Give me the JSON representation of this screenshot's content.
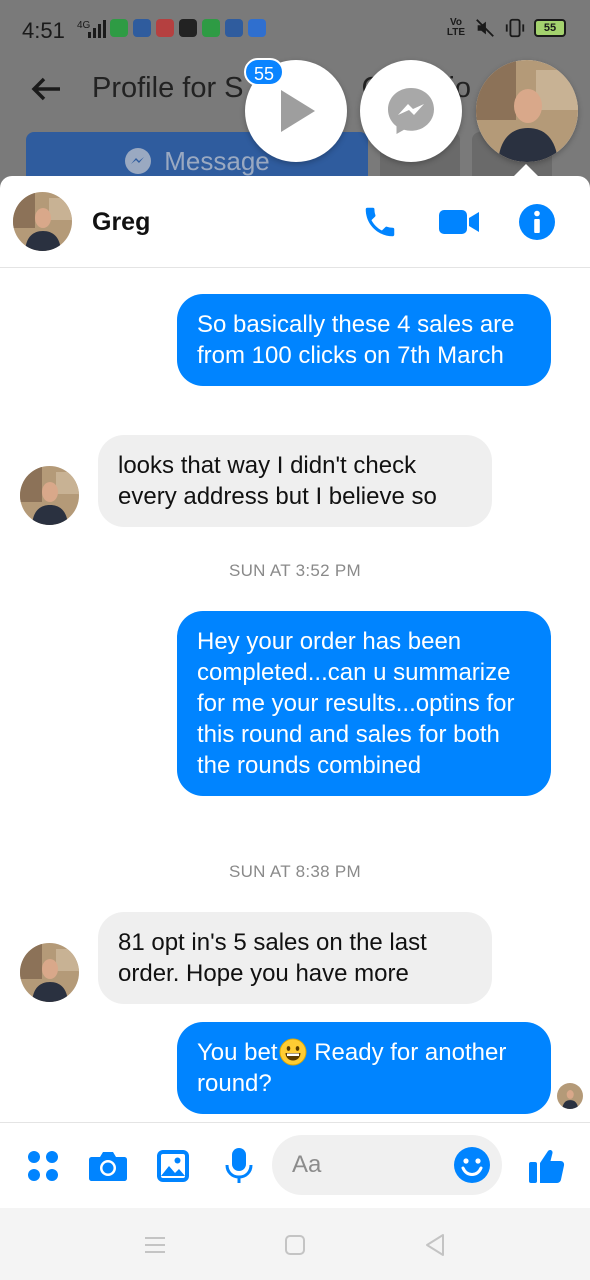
{
  "status_bar": {
    "time": "4:51",
    "network": "4G",
    "battery": "55",
    "volte": "Vo LTE"
  },
  "background": {
    "title": "Profile for S",
    "title_tail": "C",
    "title_end": "io",
    "message_button_label": "Message",
    "chathead_badge": "55"
  },
  "header": {
    "contact_name": "Greg"
  },
  "messages": [
    {
      "id": "m1",
      "direction": "outgoing",
      "text": "So basically these 4 sales are from 100 clicks on 7th March"
    },
    {
      "id": "m2",
      "direction": "incoming",
      "text": "looks that way I didn't check every address but I believe so"
    },
    {
      "id": "t1",
      "type": "timestamp",
      "text": "SUN AT 3:52 PM"
    },
    {
      "id": "m3",
      "direction": "outgoing",
      "text": "Hey your order has been completed...can u summarize for me your results...optins for this round and sales for both the rounds combined"
    },
    {
      "id": "t2",
      "type": "timestamp",
      "text": "SUN AT 8:38 PM"
    },
    {
      "id": "m4",
      "direction": "incoming",
      "text": "81 opt in's 5 sales on the last order.  Hope you have more"
    },
    {
      "id": "m5",
      "direction": "outgoing",
      "text_before_emoji": "You bet",
      "emoji": "grinning-face",
      "text_after_emoji": " Ready for another round?"
    }
  ],
  "composer": {
    "placeholder": "Aa"
  },
  "colors": {
    "accent": "#0084ff",
    "incoming_bubble": "#efefef",
    "outgoing_text": "#ffffff"
  },
  "icons": [
    "back-arrow-icon",
    "play-icon",
    "messenger-icon",
    "phone-icon",
    "video-camera-icon",
    "info-icon",
    "apps-grid-icon",
    "camera-icon",
    "gallery-icon",
    "microphone-icon",
    "emoji-icon",
    "thumbs-up-icon"
  ]
}
